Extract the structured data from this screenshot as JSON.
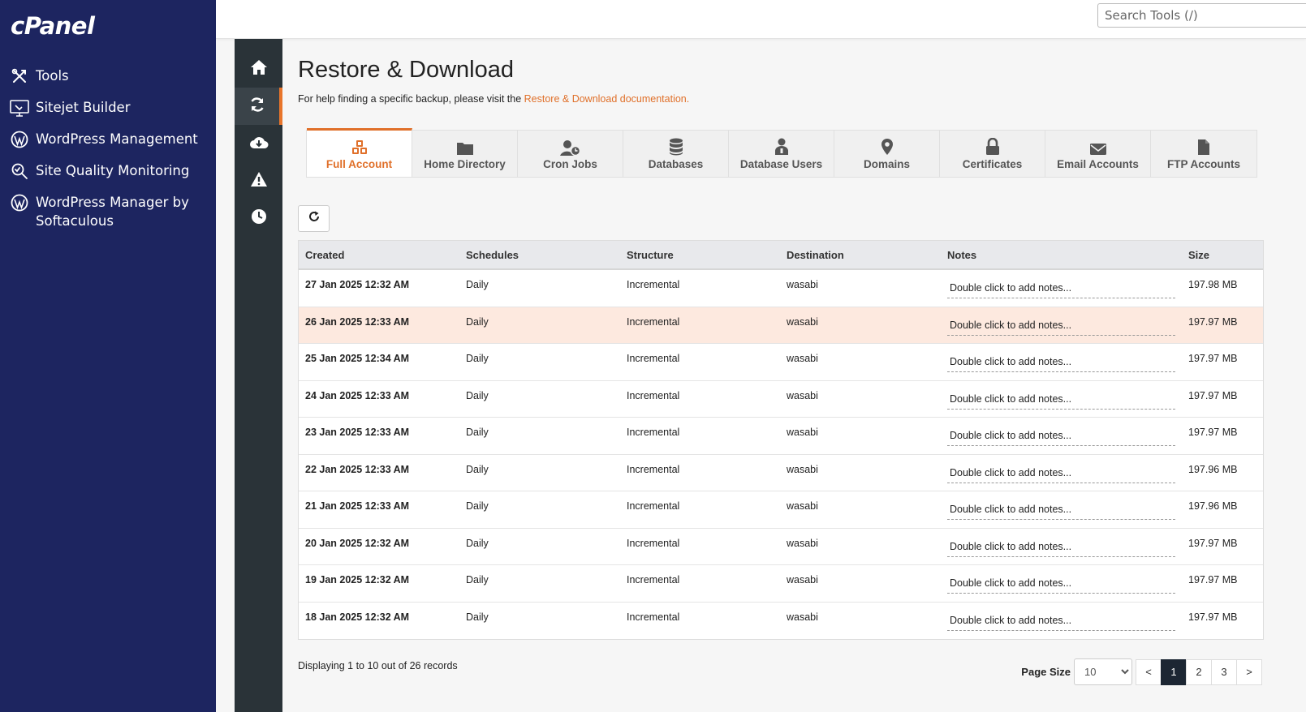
{
  "app": {
    "logo": "cPanel"
  },
  "sidebar": {
    "items": [
      {
        "label": "Tools",
        "icon": "tools-icon"
      },
      {
        "label": "Sitejet Builder",
        "icon": "sitejet-icon"
      },
      {
        "label": "WordPress Management",
        "icon": "wordpress-icon"
      },
      {
        "label": "Site Quality Monitoring",
        "icon": "magnifier-icon"
      },
      {
        "label": "WordPress Manager by Softaculous",
        "icon": "wordpress-icon"
      }
    ]
  },
  "search": {
    "placeholder": "Search Tools (/)"
  },
  "rail": {
    "items": [
      "home-icon",
      "sync-icon",
      "cloud-download-icon",
      "warning-icon",
      "clock-icon"
    ],
    "active_index": 1
  },
  "page": {
    "title": "Restore & Download",
    "help_prefix": "For help finding a specific backup, please visit the ",
    "help_link": "Restore & Download documentation."
  },
  "tabs": [
    {
      "label": "Full Account",
      "icon": "cubes-icon",
      "active": true
    },
    {
      "label": "Home Directory",
      "icon": "folder-icon"
    },
    {
      "label": "Cron Jobs",
      "icon": "user-clock-icon"
    },
    {
      "label": "Databases",
      "icon": "database-icon"
    },
    {
      "label": "Database Users",
      "icon": "db-user-icon"
    },
    {
      "label": "Domains",
      "icon": "map-pin-icon"
    },
    {
      "label": "Certificates",
      "icon": "lock-icon"
    },
    {
      "label": "Email Accounts",
      "icon": "envelope-icon"
    },
    {
      "label": "FTP Accounts",
      "icon": "file-icon"
    }
  ],
  "table": {
    "headers": [
      "Created",
      "Schedules",
      "Structure",
      "Destination",
      "Notes",
      "Size"
    ],
    "highlight_row": 1,
    "rows": [
      {
        "created": "27 Jan 2025 12:32 AM",
        "schedule": "Daily",
        "structure": "Incremental",
        "destination": "wasabi",
        "notes": "Double click to add notes...",
        "size": "197.98 MB"
      },
      {
        "created": "26 Jan 2025 12:33 AM",
        "schedule": "Daily",
        "structure": "Incremental",
        "destination": "wasabi",
        "notes": "Double click to add notes...",
        "size": "197.97 MB"
      },
      {
        "created": "25 Jan 2025 12:34 AM",
        "schedule": "Daily",
        "structure": "Incremental",
        "destination": "wasabi",
        "notes": "Double click to add notes...",
        "size": "197.97 MB"
      },
      {
        "created": "24 Jan 2025 12:33 AM",
        "schedule": "Daily",
        "structure": "Incremental",
        "destination": "wasabi",
        "notes": "Double click to add notes...",
        "size": "197.97 MB"
      },
      {
        "created": "23 Jan 2025 12:33 AM",
        "schedule": "Daily",
        "structure": "Incremental",
        "destination": "wasabi",
        "notes": "Double click to add notes...",
        "size": "197.97 MB"
      },
      {
        "created": "22 Jan 2025 12:33 AM",
        "schedule": "Daily",
        "structure": "Incremental",
        "destination": "wasabi",
        "notes": "Double click to add notes...",
        "size": "197.96 MB"
      },
      {
        "created": "21 Jan 2025 12:33 AM",
        "schedule": "Daily",
        "structure": "Incremental",
        "destination": "wasabi",
        "notes": "Double click to add notes...",
        "size": "197.96 MB"
      },
      {
        "created": "20 Jan 2025 12:32 AM",
        "schedule": "Daily",
        "structure": "Incremental",
        "destination": "wasabi",
        "notes": "Double click to add notes...",
        "size": "197.97 MB"
      },
      {
        "created": "19 Jan 2025 12:32 AM",
        "schedule": "Daily",
        "structure": "Incremental",
        "destination": "wasabi",
        "notes": "Double click to add notes...",
        "size": "197.97 MB"
      },
      {
        "created": "18 Jan 2025 12:32 AM",
        "schedule": "Daily",
        "structure": "Incremental",
        "destination": "wasabi",
        "notes": "Double click to add notes...",
        "size": "197.97 MB"
      }
    ]
  },
  "footer": {
    "display_text": "Displaying 1 to 10 out of 26 records",
    "page_size_label": "Page Size",
    "page_size_value": "10",
    "prev": "<",
    "pages": [
      "1",
      "2",
      "3"
    ],
    "current_page": "1",
    "next": ">"
  },
  "colors": {
    "sidebar_bg": "#1d2560",
    "rail_bg": "#2a3338",
    "accent": "#e0702a",
    "highlight_row": "#fde9df",
    "active_page": "#1c2633"
  }
}
